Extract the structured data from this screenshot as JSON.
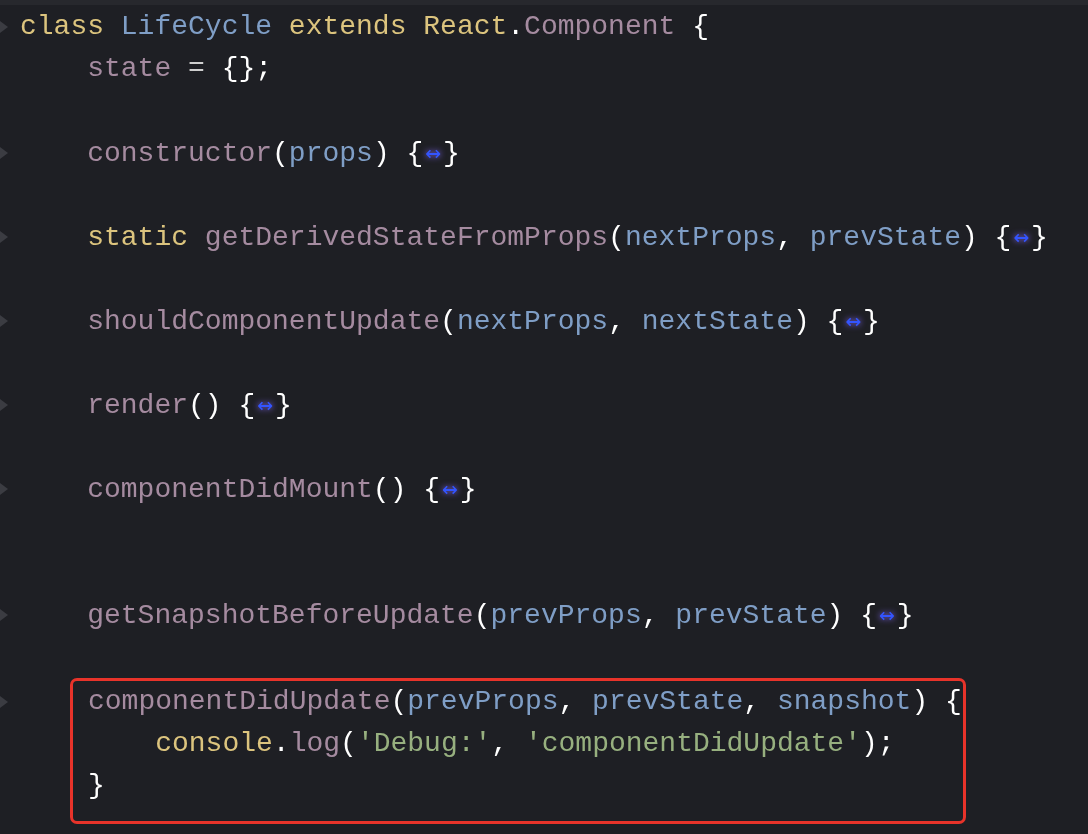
{
  "lines": [
    {
      "foldable": true,
      "tokens": [
        {
          "kind": "keyword",
          "text": "class"
        },
        {
          "kind": "type",
          "text": " LifeCycle"
        },
        {
          "kind": "keyword",
          "text": " extends React"
        },
        {
          "kind": "punct",
          "text": "."
        },
        {
          "kind": "name",
          "text": "Component"
        },
        {
          "kind": "punct",
          "text": " {"
        }
      ]
    },
    {
      "foldable": false,
      "tokens": [
        {
          "kind": "name",
          "text": "    state"
        },
        {
          "kind": "op",
          "text": " = "
        },
        {
          "kind": "punct",
          "text": "{};"
        }
      ]
    },
    {
      "foldable": false
    },
    {
      "foldable": true,
      "tokens": [
        {
          "kind": "name",
          "text": "    constructor"
        },
        {
          "kind": "punct",
          "text": "("
        },
        {
          "kind": "param",
          "text": "props"
        },
        {
          "kind": "punct",
          "text": ") {"
        },
        {
          "kind": "fold",
          "text": "↔"
        },
        {
          "kind": "punct",
          "text": "}"
        }
      ]
    },
    {
      "foldable": false
    },
    {
      "foldable": true,
      "tokens": [
        {
          "kind": "keyword",
          "text": "    static"
        },
        {
          "kind": "name",
          "text": " getDerivedStateFromProps"
        },
        {
          "kind": "punct",
          "text": "("
        },
        {
          "kind": "param",
          "text": "nextProps"
        },
        {
          "kind": "punct",
          "text": ", "
        },
        {
          "kind": "param",
          "text": "prevState"
        },
        {
          "kind": "punct",
          "text": ") {"
        },
        {
          "kind": "fold",
          "text": "↔"
        },
        {
          "kind": "punct",
          "text": "}"
        }
      ]
    },
    {
      "foldable": false
    },
    {
      "foldable": true,
      "tokens": [
        {
          "kind": "name",
          "text": "    shouldComponentUpdate"
        },
        {
          "kind": "punct",
          "text": "("
        },
        {
          "kind": "param",
          "text": "nextProps"
        },
        {
          "kind": "punct",
          "text": ", "
        },
        {
          "kind": "param",
          "text": "nextState"
        },
        {
          "kind": "punct",
          "text": ") {"
        },
        {
          "kind": "fold",
          "text": "↔"
        },
        {
          "kind": "punct",
          "text": "}"
        }
      ]
    },
    {
      "foldable": false
    },
    {
      "foldable": true,
      "tokens": [
        {
          "kind": "name",
          "text": "    render"
        },
        {
          "kind": "punct",
          "text": "() {"
        },
        {
          "kind": "fold",
          "text": "↔"
        },
        {
          "kind": "punct",
          "text": "}"
        }
      ]
    },
    {
      "foldable": false
    },
    {
      "foldable": true,
      "tokens": [
        {
          "kind": "name",
          "text": "    componentDidMount"
        },
        {
          "kind": "punct",
          "text": "() {"
        },
        {
          "kind": "fold",
          "text": "↔"
        },
        {
          "kind": "punct",
          "text": "}"
        }
      ]
    },
    {
      "foldable": false
    },
    {
      "foldable": false
    },
    {
      "foldable": true,
      "tokens": [
        {
          "kind": "name",
          "text": "    getSnapshotBeforeUpdate"
        },
        {
          "kind": "punct",
          "text": "("
        },
        {
          "kind": "param",
          "text": "prevProps"
        },
        {
          "kind": "punct",
          "text": ", "
        },
        {
          "kind": "param",
          "text": "prevState"
        },
        {
          "kind": "punct",
          "text": ") {"
        },
        {
          "kind": "fold",
          "text": "↔"
        },
        {
          "kind": "punct",
          "text": "}"
        }
      ]
    },
    {
      "foldable": false
    }
  ],
  "highlight": {
    "lines": [
      {
        "foldable": true,
        "tokens": [
          {
            "kind": "name",
            "text": "componentDidUpdate"
          },
          {
            "kind": "punct",
            "text": "("
          },
          {
            "kind": "param",
            "text": "prevProps"
          },
          {
            "kind": "punct",
            "text": ", "
          },
          {
            "kind": "param",
            "text": "prevState"
          },
          {
            "kind": "punct",
            "text": ", "
          },
          {
            "kind": "param",
            "text": "snapshot"
          },
          {
            "kind": "punct",
            "text": ") {"
          }
        ]
      },
      {
        "foldable": false,
        "tokens": [
          {
            "kind": "keyword",
            "text": "    console"
          },
          {
            "kind": "punct",
            "text": "."
          },
          {
            "kind": "name",
            "text": "log"
          },
          {
            "kind": "punct",
            "text": "("
          },
          {
            "kind": "string",
            "text": "'Debug:'"
          },
          {
            "kind": "punct",
            "text": ", "
          },
          {
            "kind": "string",
            "text": "'componentDidUpdate'"
          },
          {
            "kind": "punct",
            "text": ");"
          }
        ]
      },
      {
        "foldable": false,
        "tokens": [
          {
            "kind": "punct",
            "text": "}"
          }
        ]
      }
    ]
  }
}
